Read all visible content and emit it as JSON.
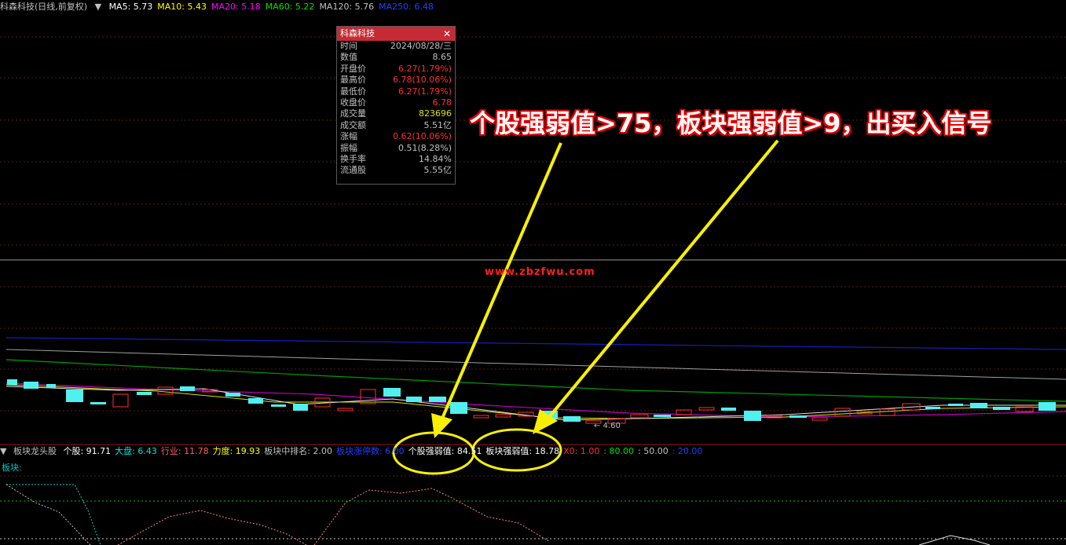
{
  "header": {
    "stock_title": "科森科技(日线,前复权)",
    "ma": [
      {
        "label": "MA5: 5.73",
        "color": "#ffffff"
      },
      {
        "label": "MA10: 5.43",
        "color": "#ffff00"
      },
      {
        "label": "MA20: 5.18",
        "color": "#ff00ff"
      },
      {
        "label": "MA60: 5.22",
        "color": "#00e000"
      },
      {
        "label": "MA120: 5.76",
        "color": "#c0c0c0"
      },
      {
        "label": "MA250: 6.48",
        "color": "#2040ff"
      }
    ]
  },
  "info_panel": {
    "title": "科森科技",
    "close_icon": "close-icon",
    "rows": [
      {
        "label": "时间",
        "value": "2024/08/28/三",
        "color": "#c0c0c0"
      },
      {
        "label": "数值",
        "value": "8.65",
        "color": "#c0c0c0"
      },
      {
        "label": "开盘价",
        "value": "6.27(1.79%)",
        "color": "#ff3030"
      },
      {
        "label": "最高价",
        "value": "6.78(10.06%)",
        "color": "#ff3030"
      },
      {
        "label": "最低价",
        "value": "6.27(1.79%)",
        "color": "#ff3030"
      },
      {
        "label": "收盘价",
        "value": "6.78",
        "color": "#ff3030"
      },
      {
        "label": "成交量",
        "value": "823696",
        "color": "#e0e000"
      },
      {
        "label": "成交额",
        "value": "5.51亿",
        "color": "#c0c0c0"
      },
      {
        "label": "涨幅",
        "value": "0.62(10.06%)",
        "color": "#ff3030"
      },
      {
        "label": "振幅",
        "value": "0.51(8.28%)",
        "color": "#c0c0c0"
      },
      {
        "label": "换手率",
        "value": "14.84%",
        "color": "#c0c0c0"
      },
      {
        "label": "流通股",
        "value": "5.55亿",
        "color": "#c0c0c0"
      }
    ]
  },
  "annotation": {
    "headline": "个股强弱值>75，板块强弱值>9，出买入信号",
    "watermark": "www.zbzfwu.com"
  },
  "chart": {
    "price_marker": "← 4.60"
  },
  "indicator": {
    "name": "板块龙头股",
    "items": [
      {
        "label": "个股: 91.71",
        "color": "#ffffff"
      },
      {
        "label": "大盘: 6.43",
        "color": "#00e0e0"
      },
      {
        "label": "行业: 11.78",
        "color": "#ff6060"
      },
      {
        "label": "力度: 19.93",
        "color": "#ffff00"
      },
      {
        "label": "板块中排名: 2.00",
        "color": "#c0c0c0"
      },
      {
        "label": "板块涨停数: 6.00",
        "color": "#2040ff"
      },
      {
        "label": "个股强弱值: 84.51",
        "color": "#ffffff"
      },
      {
        "label": "板块强弱值: 18.78",
        "color": "#ffffff"
      },
      {
        "label": "X0: 1.00",
        "color": "#ff3030"
      },
      {
        "label": ": 80.00",
        "color": "#00e000"
      },
      {
        "label": ": 50.00",
        "color": "#c0c0c0"
      },
      {
        "label": ": 20.00",
        "color": "#2040ff"
      }
    ],
    "sub_label": "板块:"
  }
}
